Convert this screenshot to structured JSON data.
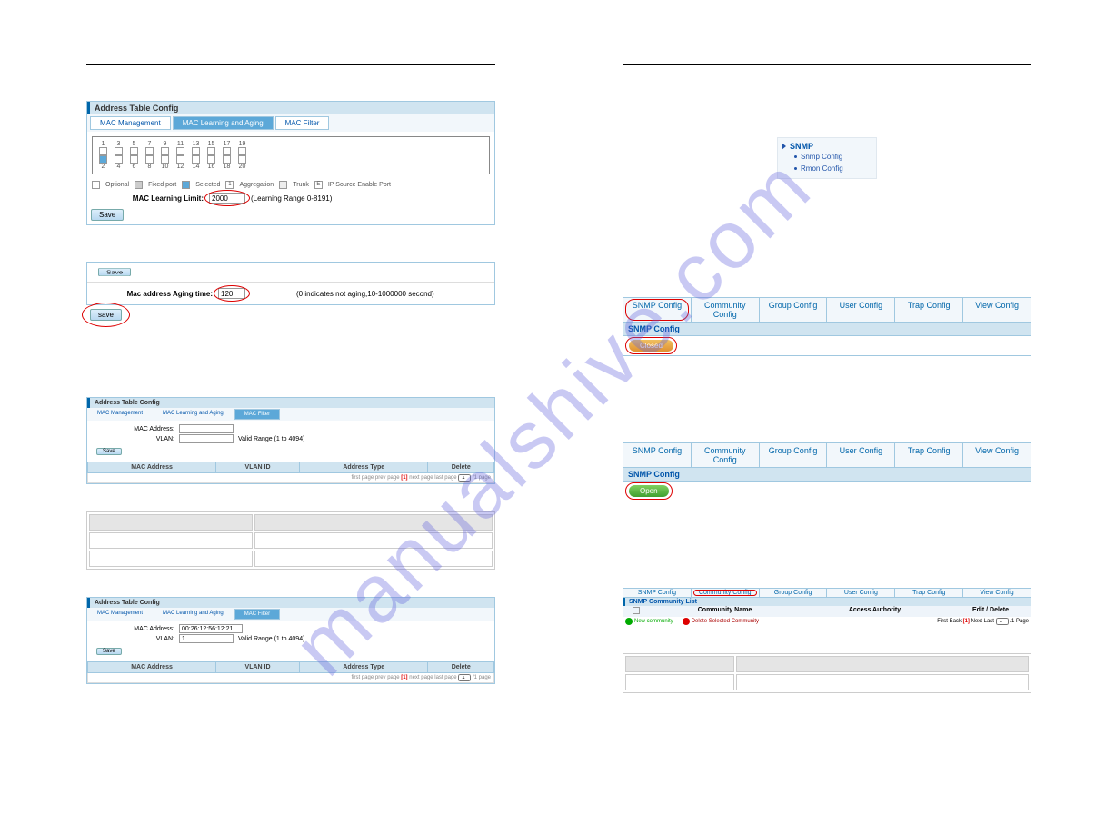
{
  "watermark": "manualshive.com",
  "left": {
    "panel1_title": "Address Table Config",
    "tabs": {
      "mac_mgmt": "MAC Management",
      "learn": "MAC Learning and Aging",
      "filter": "MAC Filter"
    },
    "port_nums_top": "1 3 5 7 9 11 13 15 17 19",
    "port_nums_bot": "2 4 6 8 10 12 14 16 18 20",
    "legend": {
      "optional": "Optional",
      "fixed": "Fixed port",
      "selected": "Selected",
      "agg": "Aggregation",
      "trunk": "Trunk",
      "ip": "IP Source Enable Port"
    },
    "mac_limit_label": "MAC Learning Limit:",
    "mac_limit_value": "2000",
    "mac_limit_hint": "(Learning Range 0-8191)",
    "save": "Save",
    "save_lower": "save",
    "aging_label": "Mac address Aging time:",
    "aging_value": "120",
    "aging_hint": "(0 indicates not aging,10-1000000 second)",
    "filter_panel_title": "Address Table Config",
    "mac_addr_label": "MAC Address:",
    "vlan_label": "VLAN:",
    "vlan_hint": "Valid Range (1 to 4094)",
    "cols": {
      "mac": "MAC Address",
      "vlan": "VLAN ID",
      "type": "Address Type",
      "del": "Delete"
    },
    "pager": {
      "first": "first page",
      "prev": "prev page",
      "cur_label": "[1]",
      "next": "next page",
      "last": "last page",
      "go_val": "1",
      "go": "/1 page"
    },
    "mac_val": "00:26:12:56:12:21",
    "vlan_val": "1"
  },
  "right": {
    "nav": {
      "snmp": "SNMP",
      "snmp_cfg": "Snmp Config",
      "rmon": "Rmon Config"
    },
    "tabs": {
      "snmp": "SNMP Config",
      "community": "Community Config",
      "group": "Group Config",
      "user": "User Config",
      "trap": "Trap Config",
      "view": "View Config"
    },
    "sub_title": "SNMP Config",
    "closed": "Closed",
    "open": "Open",
    "comm_list": "SNMP Community List",
    "comm_cols": {
      "name": "Community Name",
      "auth": "Access Authority",
      "edit": "Edit / Delete"
    },
    "new_comm": "New community",
    "del_sel": "Delete Selected Community",
    "pager2": {
      "first": "First",
      "back": "Back",
      "cur": "[1]",
      "next": "Next",
      "last": "Last",
      "go_val": "1",
      "go": "/1 Page"
    }
  }
}
